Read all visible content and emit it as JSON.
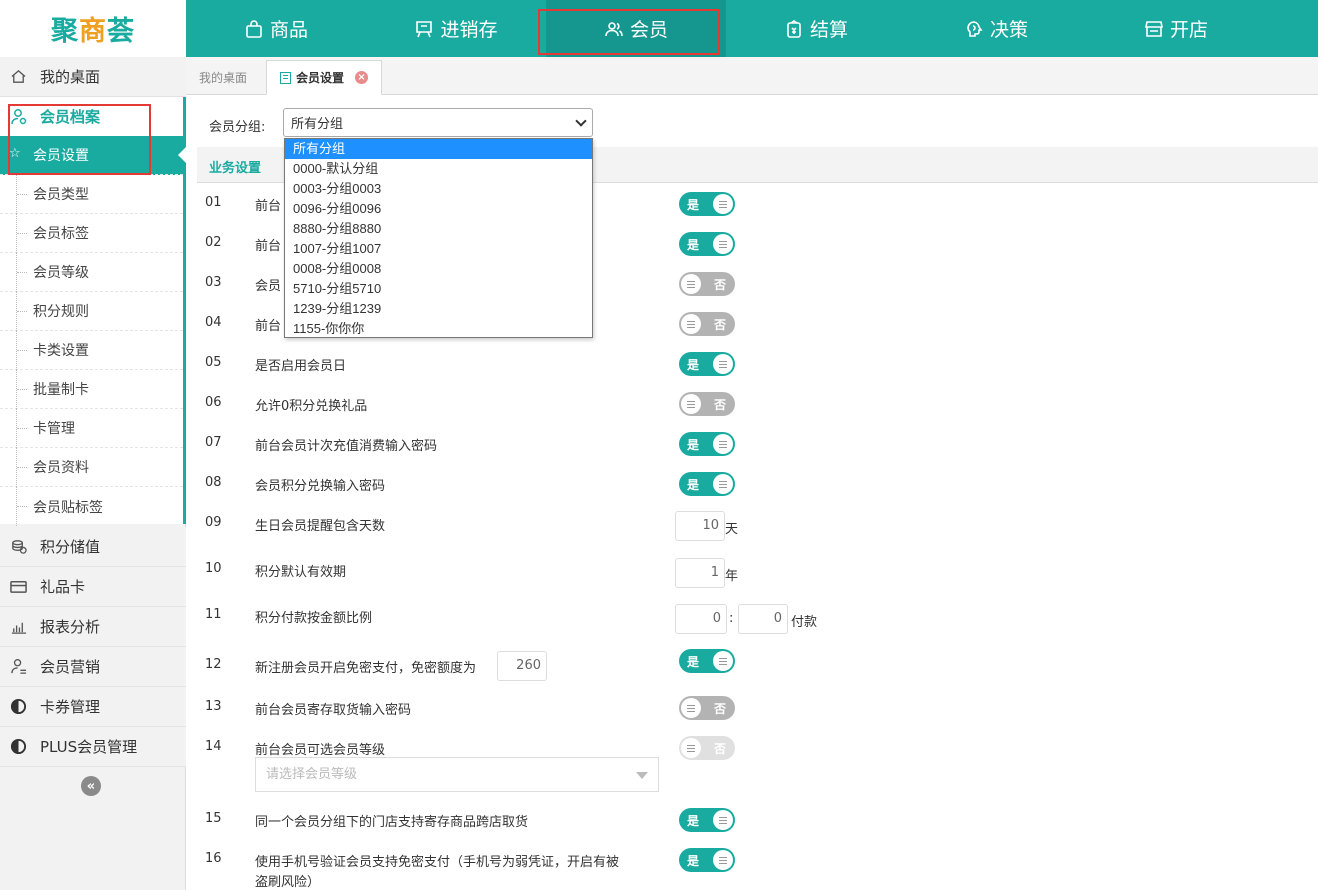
{
  "app": {
    "logo": {
      "part1": "聚",
      "part2": "商",
      "part3": "荟"
    },
    "nav": [
      {
        "label": "商品",
        "icon": "bag-icon"
      },
      {
        "label": "进销存",
        "icon": "board-icon"
      },
      {
        "label": "会员",
        "icon": "users-icon"
      },
      {
        "label": "结算",
        "icon": "wallet-icon"
      },
      {
        "label": "决策",
        "icon": "brain-icon"
      },
      {
        "label": "开店",
        "icon": "store-icon"
      }
    ],
    "active_nav": "会员"
  },
  "sidebar": {
    "desktop": "我的桌面",
    "archive_head": "会员档案",
    "archive_items": [
      "会员设置",
      "会员类型",
      "会员标签",
      "会员等级",
      "积分规则",
      "卡类设置",
      "批量制卡",
      "卡管理",
      "会员资料",
      "会员贴标签"
    ],
    "modules": [
      {
        "label": "积分储值",
        "icon": "coins-icon"
      },
      {
        "label": "礼品卡",
        "icon": "card-icon"
      },
      {
        "label": "报表分析",
        "icon": "bar-chart-icon"
      },
      {
        "label": "会员营销",
        "icon": "user-marketing-icon"
      },
      {
        "label": "卡券管理",
        "icon": "half-circle-icon"
      },
      {
        "label": "PLUS会员管理",
        "icon": "half-circle-icon"
      }
    ],
    "collapse": "«"
  },
  "tabs": {
    "home": "我的桌面",
    "current": "会员设置",
    "close": "×"
  },
  "filter": {
    "label": "会员分组:",
    "selected": "所有分组",
    "options": [
      "所有分组",
      "0000-默认分组",
      "0003-分组0003",
      "0096-分组0096",
      "8880-分组8880",
      "1007-分组1007",
      "0008-分组0008",
      "5710-分组5710",
      "1239-分组1239",
      "1155-你你你"
    ]
  },
  "section_title": "业务设置",
  "toggle_text": {
    "on": "是",
    "off": "否"
  },
  "settings": [
    {
      "no": "01",
      "label": "前台",
      "state": "on"
    },
    {
      "no": "02",
      "label": "前台",
      "state": "on"
    },
    {
      "no": "03",
      "label": "会员",
      "state": "off"
    },
    {
      "no": "04",
      "label": "前台",
      "state": "off"
    },
    {
      "no": "05",
      "label": "是否启用会员日",
      "state": "on"
    },
    {
      "no": "06",
      "label": "允许0积分兑换礼品",
      "state": "off"
    },
    {
      "no": "07",
      "label": "前台会员计次充值消费输入密码",
      "state": "on"
    },
    {
      "no": "08",
      "label": "会员积分兑换输入密码",
      "state": "on"
    },
    {
      "no": "09",
      "label": "生日会员提醒包含天数",
      "value": "10",
      "unit": "天"
    },
    {
      "no": "10",
      "label": "积分默认有效期",
      "value": "1",
      "unit": "年"
    },
    {
      "no": "11",
      "label": "积分付款按金额比例",
      "value_a": "0",
      "sep": ":",
      "value_b": "0",
      "unit": "付款"
    },
    {
      "no": "12",
      "label": "新注册会员开启免密支付，免密额度为",
      "value": "260",
      "state": "on"
    },
    {
      "no": "13",
      "label": "前台会员寄存取货输入密码",
      "state": "off"
    },
    {
      "no": "14",
      "label": "前台会员可选会员等级",
      "state": "disabled",
      "placeholder": "请选择会员等级"
    },
    {
      "no": "15",
      "label": "同一个会员分组下的门店支持寄存商品跨店取货",
      "state": "on"
    },
    {
      "no": "16",
      "label": "使用手机号验证会员支持免密支付（手机号为弱凭证，开启有被",
      "label2": "盗刷风险）",
      "state": "on"
    }
  ],
  "colors": {
    "primary": "#1aaba0",
    "highlight_box": "#e53935",
    "dropdown_selected": "#1e90ff"
  }
}
